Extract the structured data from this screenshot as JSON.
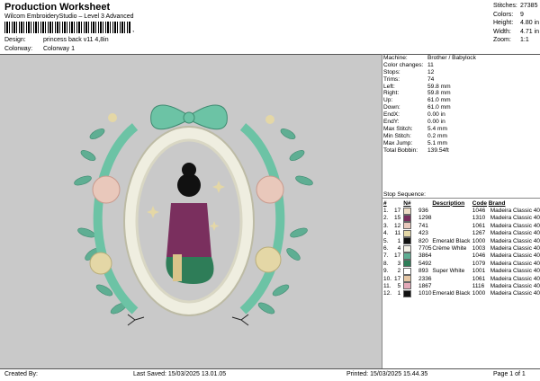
{
  "header": {
    "title": "Production Worksheet",
    "subtitle": "Wilcom EmbroideryStudio – Level 3 Advanced",
    "barcode_mark": ","
  },
  "design": {
    "design_label": "Design:",
    "design_value": "princess back v11 4,8in",
    "colorway_label": "Colorway:",
    "colorway_value": "Colorway 1"
  },
  "top_stats": [
    {
      "k": "Stitches:",
      "v": "27385"
    },
    {
      "k": "Colors:",
      "v": "9"
    },
    {
      "k": "Height:",
      "v": "4.80 in"
    },
    {
      "k": "Width:",
      "v": "4.71 in"
    },
    {
      "k": "Zoom:",
      "v": "1:1"
    }
  ],
  "info": [
    {
      "k": "Machine:",
      "v": "Brother / Babylock"
    },
    {
      "k": "Color changes:",
      "v": "11"
    },
    {
      "k": "Stops:",
      "v": "12"
    },
    {
      "k": "Trims:",
      "v": "74"
    },
    {
      "k": "Left:",
      "v": "59.8 mm"
    },
    {
      "k": "Right:",
      "v": "59.8 mm"
    },
    {
      "k": "Up:",
      "v": "61.0 mm"
    },
    {
      "k": "Down:",
      "v": "61.0 mm"
    },
    {
      "k": "EndX:",
      "v": "0.00 in"
    },
    {
      "k": "EndY:",
      "v": "0.00 in"
    },
    {
      "k": "Max Stitch:",
      "v": "5.4 mm"
    },
    {
      "k": "Min Stitch:",
      "v": "0.2 mm"
    },
    {
      "k": "Max Jump:",
      "v": "5.1 mm"
    },
    {
      "k": "Total Bobbin:",
      "v": "139.54ft"
    }
  ],
  "sequence": {
    "title": "Stop Sequence:",
    "headers": [
      "#",
      "N#",
      "",
      "Description",
      "Code",
      "Brand"
    ],
    "rows": [
      {
        "n": "1.",
        "needle": "17",
        "color": "#eddcc5",
        "num": "936",
        "desc": "",
        "code": "1046",
        "brand": "Madeira Classic 40"
      },
      {
        "n": "2.",
        "needle": "15",
        "color": "#7a2f5e",
        "num": "1298",
        "desc": "",
        "code": "1310",
        "brand": "Madeira Classic 40"
      },
      {
        "n": "3.",
        "needle": "12",
        "color": "#e9c8bb",
        "num": "741",
        "desc": "",
        "code": "1061",
        "brand": "Madeira Classic 40"
      },
      {
        "n": "4.",
        "needle": "11",
        "color": "#e4d7a6",
        "num": "423",
        "desc": "",
        "code": "1267",
        "brand": "Madeira Classic 40"
      },
      {
        "n": "5.",
        "needle": "1",
        "color": "#111111",
        "num": "820",
        "desc": "Emerald Black",
        "code": "1000",
        "brand": "Madeira Classic 40"
      },
      {
        "n": "6.",
        "needle": "4",
        "color": "#f4f1e6",
        "num": "7705",
        "desc": "Crème White",
        "code": "1003",
        "brand": "Madeira Classic 40"
      },
      {
        "n": "7.",
        "needle": "17",
        "color": "#5fae93",
        "num": "3864",
        "desc": "",
        "code": "1046",
        "brand": "Madeira Classic 40"
      },
      {
        "n": "8.",
        "needle": "3",
        "color": "#2e7d58",
        "num": "5492",
        "desc": "",
        "code": "1079",
        "brand": "Madeira Classic 40"
      },
      {
        "n": "9.",
        "needle": "2",
        "color": "#ffffff",
        "num": "893",
        "desc": "Super White",
        "code": "1001",
        "brand": "Madeira Classic 40"
      },
      {
        "n": "10.",
        "needle": "17",
        "color": "#e6c7a5",
        "num": "2336",
        "desc": "",
        "code": "1061",
        "brand": "Madeira Classic 40"
      },
      {
        "n": "11.",
        "needle": "5",
        "color": "#e3a9b8",
        "num": "1867",
        "desc": "",
        "code": "1116",
        "brand": "Madeira Classic 40"
      },
      {
        "n": "12.",
        "needle": "1",
        "color": "#111111",
        "num": "1010",
        "desc": "Emerald Black",
        "code": "1000",
        "brand": "Madeira Classic 40"
      }
    ]
  },
  "footer": {
    "created": "Created By:",
    "saved": "Last Saved: 15/03/2025 13.01.05",
    "printed": "Printed: 15/03/2025 15.44.35",
    "page": "Page 1 of 1"
  }
}
